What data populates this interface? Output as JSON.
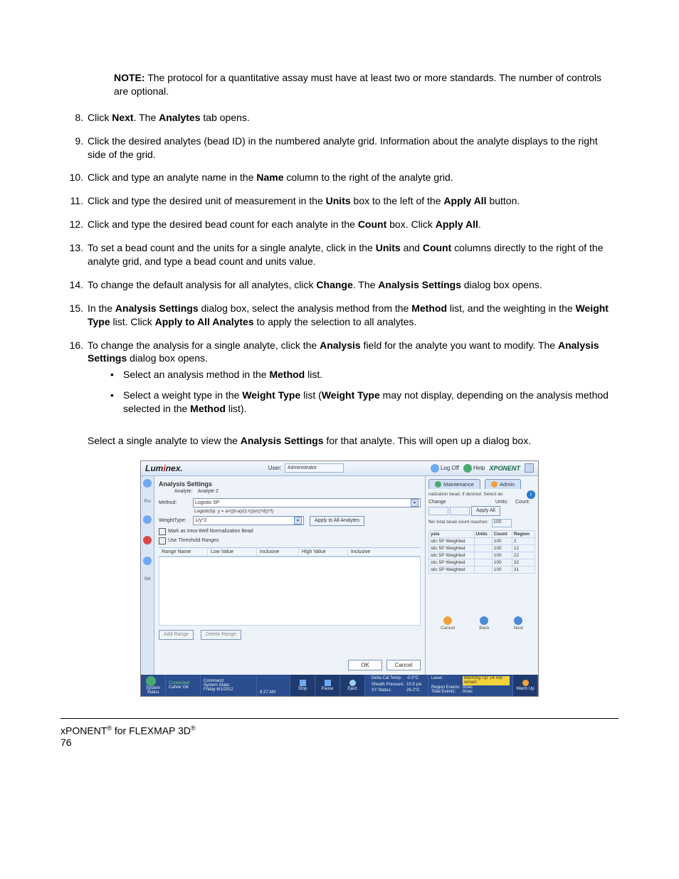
{
  "note": {
    "label": "NOTE:",
    "text": "The protocol for a quantitative assay must have at least two or more standards. The number of controls are optional."
  },
  "steps": [
    {
      "n": "8.",
      "html": "Click <b>Next</b>. The <b>Analytes</b> tab opens."
    },
    {
      "n": "9.",
      "html": "Click the desired analytes (bead ID) in the numbered analyte grid. Information about the analyte displays to the right side of the grid."
    },
    {
      "n": "10.",
      "html": "Click and type an analyte name in the <b>Name</b> column to the right of the analyte grid."
    },
    {
      "n": "11.",
      "html": "Click and type the desired unit of measurement in the <b>Units</b> box to the left of the <b>Apply All</b> button."
    },
    {
      "n": "12.",
      "html": "Click and type the desired bead count for each analyte in the <b>Count</b> box. Click <b>Apply All</b>."
    },
    {
      "n": "13.",
      "html": "To set a bead count and the units for a single analyte, click in the <b>Units</b> and <b>Count</b> columns directly to the right of the analyte grid, and type a bead count and units value."
    },
    {
      "n": "14.",
      "html": "To change the default analysis for all analytes, click <b>Change</b>. The <b>Analysis Settings</b> dialog box opens."
    },
    {
      "n": "15.",
      "html": "In the <b>Analysis Settings</b> dialog box, select the analysis method from the <b>Method</b> list, and the weighting in the <b>Weight Type</b> list. Click <b>Apply to All Analytes</b> to apply the selection to all analytes."
    },
    {
      "n": "16.",
      "html": "To change the analysis for a single analyte, click the <b>Analysis</b> field for the analyte you want to modify. The <b>Analysis Settings</b> dialog box opens."
    }
  ],
  "subs": [
    {
      "html": "Select an analysis method in the <b>Method</b> list."
    },
    {
      "html": "Select a weight type in the <b>Weight Type</b> list (<b>Weight Type</b> may not display, depending on the analysis method selected in the <b>Method</b> list)."
    }
  ],
  "closing": {
    "html": "Select a single analyte to view the <b>Analysis Settings</b> for that analyte. This will open up a dialog box."
  },
  "footer": {
    "line1_before": "xPONENT",
    "line1_mid": " for FLEXMAP 3D",
    "reg": "®",
    "page": "76"
  },
  "app": {
    "brand_a": "Lum",
    "brand_b": "nex",
    "user_label": "User:",
    "user_value": "Administrator",
    "logoff": "Log Off",
    "help": "Help",
    "product": "XPONENT",
    "dialog_title": "Analysis Settings",
    "analyte_label": "Analyte:",
    "analyte_value": "Analyte 2",
    "method_label": "Method:",
    "method_value": "Logistic 5P",
    "formula": "Logistic5p: y = a+((b-a)/(1+((x/c)^d))^f)",
    "weight_label": "WeightType:",
    "weight_value": "1/y^2",
    "apply_all_analytes": "Apply to All Analytes",
    "mark_bead": "Mark as Intra-Well Normalization Bead",
    "use_thresh": "Use Threshold Ranges",
    "range_cols": [
      "Range Name",
      "Low Value",
      "Inclusive",
      "High Value",
      "Inclusive"
    ],
    "add_range": "Add Range",
    "delete_range": "Delete Range",
    "ok": "OK",
    "cancel": "Cancel",
    "tabs": {
      "maint": "Maintenance",
      "admin": "Admin"
    },
    "rp_note": "nalization bead, if desired. Select an",
    "rp_cols": {
      "change": "Change",
      "units": "Units:",
      "count": "Count:"
    },
    "rp_apply": "Apply All",
    "rp_reach": "fter total bead count reaches:",
    "rp_reach_val": "100",
    "rp_tbl_hdr": [
      "ysis",
      "Units",
      "Count",
      "Region"
    ],
    "rp_rows": [
      [
        "stic 5P Weighted",
        "",
        "100",
        "2"
      ],
      [
        "stic 5P Weighted",
        "",
        "100",
        "12"
      ],
      [
        "stic 5P Weighted",
        "",
        "100",
        "22"
      ],
      [
        "stic 5P Weighted",
        "",
        "100",
        "32"
      ],
      [
        "stic 5P Weighted",
        "",
        "100",
        "31"
      ]
    ],
    "nav": {
      "cancel": "Cancel",
      "back": "Back",
      "next": "Next"
    },
    "status": {
      "sys_status": "System Status",
      "connected": "Connected",
      "command": "Command:",
      "state": "System State:",
      "date": "Friday 6/1/2012",
      "time": "8:27 AM",
      "stop": "Stop",
      "pause": "Pause",
      "eject": "Eject",
      "delta": "Delta Cal Temp:",
      "delta_v": "-0.0°C",
      "sheath": "Sheath Pressure:",
      "sheath_v": "10.5 psi",
      "xy": "XY Status:",
      "xy_v": "26.2°C",
      "laser": "Laser:",
      "laser_v": "Warming Up: 14 min remain",
      "reg": "Region Events:",
      "reg_v": "0/sec",
      "tot": "Total Events:",
      "tot_v": "0/sec",
      "warmup": "Warm Up"
    }
  }
}
